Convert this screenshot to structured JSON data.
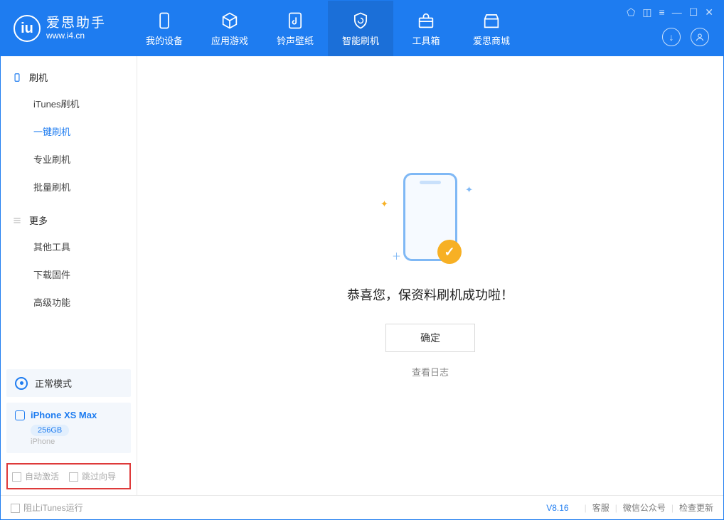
{
  "app": {
    "title": "爱思助手",
    "url": "www.i4.cn"
  },
  "nav": {
    "items": [
      {
        "label": "我的设备"
      },
      {
        "label": "应用游戏"
      },
      {
        "label": "铃声壁纸"
      },
      {
        "label": "智能刷机"
      },
      {
        "label": "工具箱"
      },
      {
        "label": "爱思商城"
      }
    ]
  },
  "sidebar": {
    "section1_title": "刷机",
    "items1": [
      {
        "label": "iTunes刷机"
      },
      {
        "label": "一键刷机"
      },
      {
        "label": "专业刷机"
      },
      {
        "label": "批量刷机"
      }
    ],
    "section2_title": "更多",
    "items2": [
      {
        "label": "其他工具"
      },
      {
        "label": "下载固件"
      },
      {
        "label": "高级功能"
      }
    ],
    "mode_label": "正常模式",
    "device_name": "iPhone XS Max",
    "device_capacity": "256GB",
    "device_type": "iPhone",
    "check_auto_activate": "自动激活",
    "check_skip_guide": "跳过向导"
  },
  "main": {
    "success_text": "恭喜您，保资料刷机成功啦！",
    "ok_button": "确定",
    "view_log": "查看日志"
  },
  "footer": {
    "block_itunes": "阻止iTunes运行",
    "version": "V8.16",
    "support": "客服",
    "wechat": "微信公众号",
    "check_update": "检查更新"
  }
}
